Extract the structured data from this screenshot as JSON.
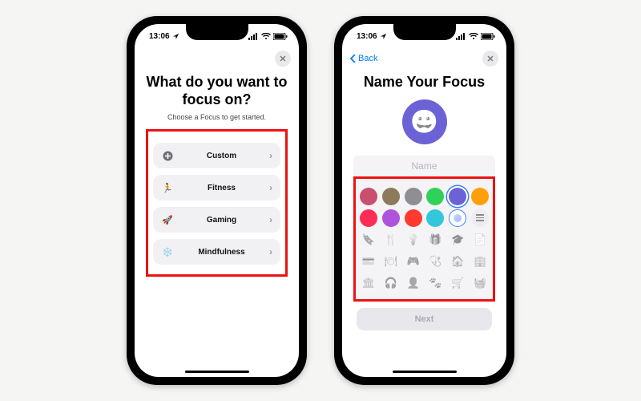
{
  "status": {
    "time": "13:06"
  },
  "screenA": {
    "title_line1": "What do you want to",
    "title_line2": "focus on?",
    "subtitle": "Choose a Focus to get started.",
    "options": [
      {
        "label": "Custom",
        "icon": "plus-circle-icon",
        "color": "#6e6e73"
      },
      {
        "label": "Fitness",
        "icon": "runner-icon",
        "color": "#30d158"
      },
      {
        "label": "Gaming",
        "icon": "rocket-icon",
        "color": "#0a84ff"
      },
      {
        "label": "Mindfulness",
        "icon": "snowflake-icon",
        "color": "#40c8e0"
      }
    ]
  },
  "screenB": {
    "back_label": "Back",
    "title": "Name Your Focus",
    "name_placeholder": "Name",
    "badge_emoji": "😀",
    "colors_row1": [
      "#c94f6f",
      "#8d7a5b",
      "#8e8e93",
      "#30d158",
      "#6b62d6",
      "#ff9f0a"
    ],
    "selected_color_index": 4,
    "colors_row2": [
      "#ff2d55",
      "#af52de",
      "#ff3b30",
      "#32c8d9"
    ],
    "glyph_rows": [
      [
        "ribbon-icon",
        "utensil-icon",
        "lightbulb-icon",
        "gift-icon",
        "graduation-icon",
        "document-icon"
      ],
      [
        "card-icon",
        "fork-knife-icon",
        "controller-icon",
        "stethoscope-icon",
        "house-icon",
        "building-icon"
      ],
      [
        "bank-icon",
        "headphones-icon",
        "person-icon",
        "paw-icon",
        "cart-icon",
        "bag-icon"
      ]
    ],
    "glyph_unicode": {
      "ribbon-icon": "🔖",
      "utensil-icon": "🍴",
      "lightbulb-icon": "💡",
      "gift-icon": "🎁",
      "graduation-icon": "🎓",
      "document-icon": "📄",
      "card-icon": "💳",
      "fork-knife-icon": "🍽",
      "controller-icon": "🎮",
      "stethoscope-icon": "🩺",
      "house-icon": "🏠",
      "building-icon": "🏢",
      "bank-icon": "🏛",
      "headphones-icon": "🎧",
      "person-icon": "👤",
      "paw-icon": "🐾",
      "cart-icon": "🛒",
      "bag-icon": "🧺"
    },
    "next_label": "Next"
  }
}
